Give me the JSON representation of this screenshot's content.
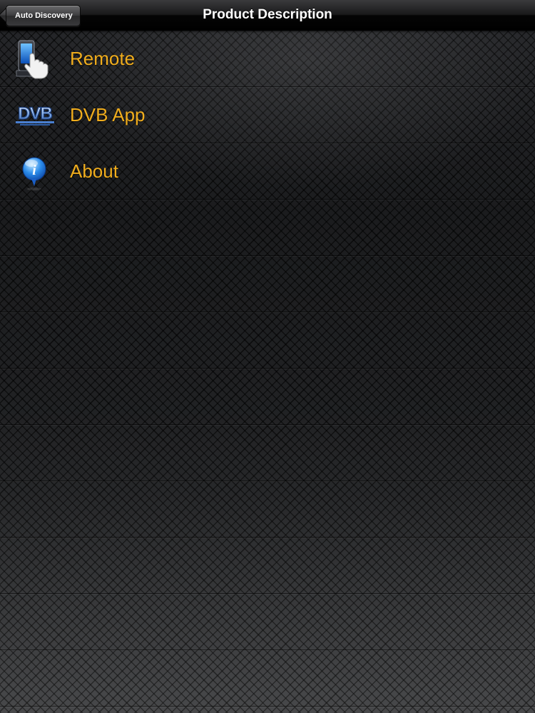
{
  "navbar": {
    "title": "Product Description",
    "back_label": "Auto Discovery"
  },
  "list": {
    "items": [
      {
        "label": "Remote",
        "icon": "remote-touch-icon"
      },
      {
        "label": "DVB App",
        "icon": "dvb-logo-icon"
      },
      {
        "label": "About",
        "icon": "info-icon"
      }
    ]
  },
  "colors": {
    "label": "#f0ad1d",
    "title": "#ffffff"
  }
}
